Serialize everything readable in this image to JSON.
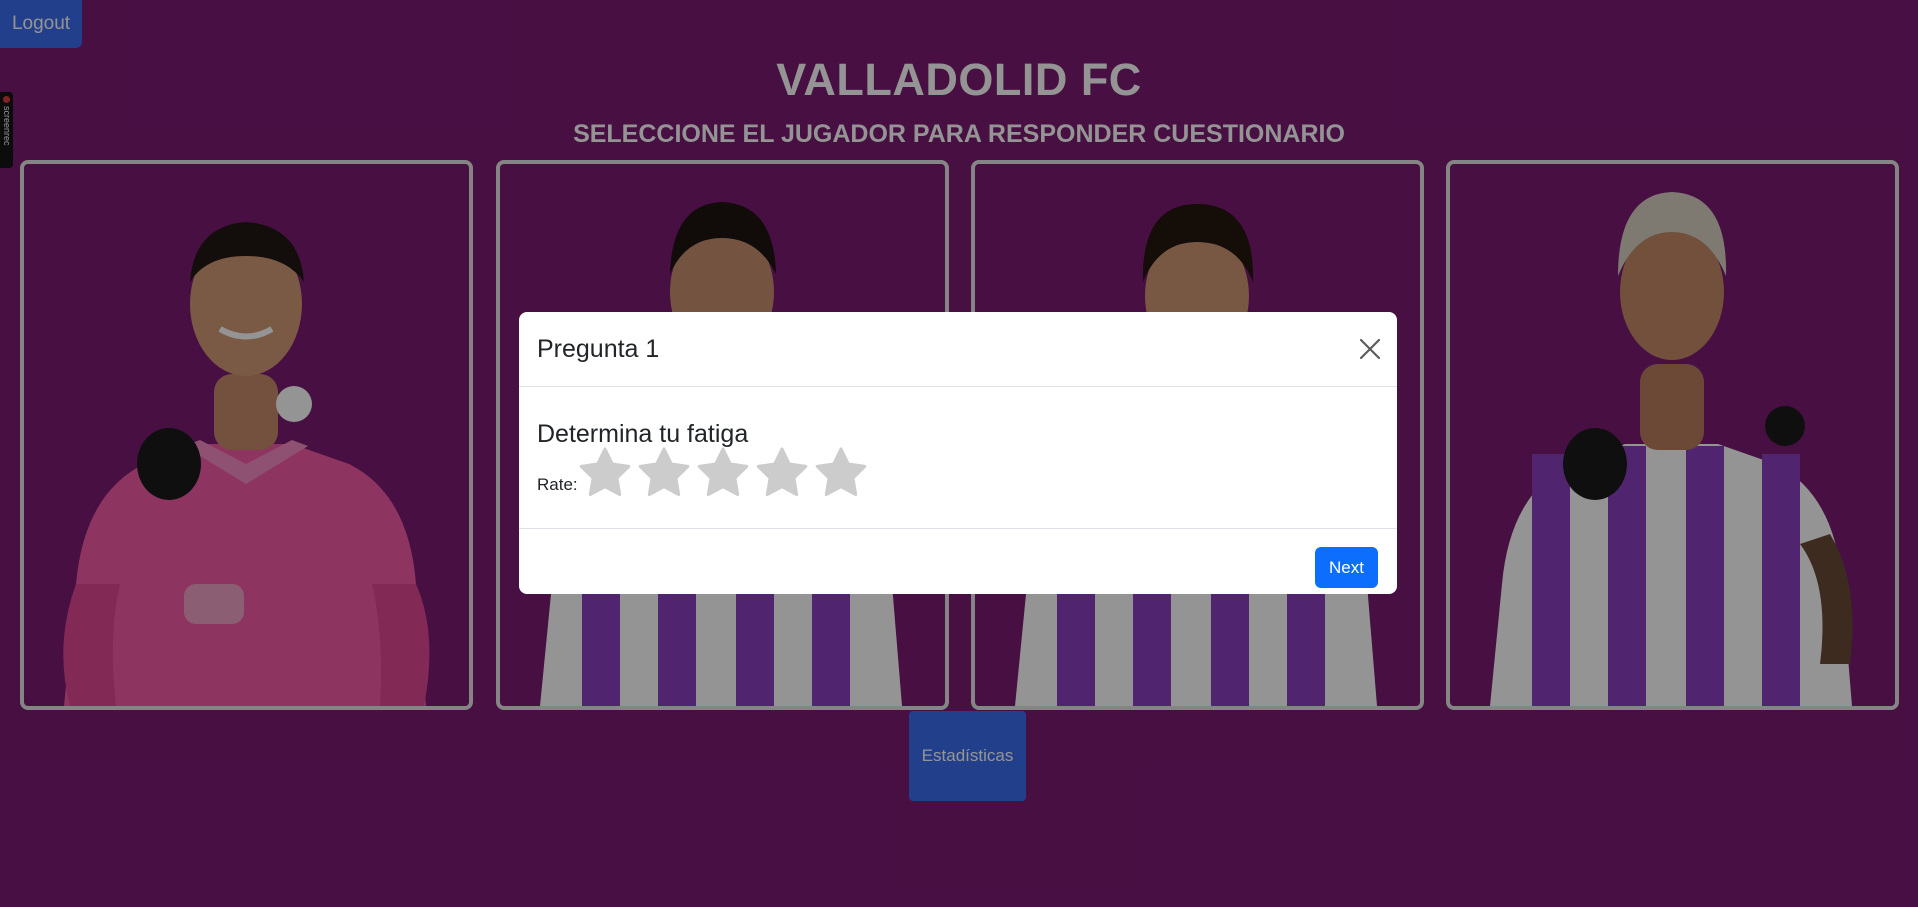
{
  "header": {
    "logout_label": "Logout",
    "title": "VALLADOLID FC",
    "subtitle": "SELECCIONE EL JUGADOR PARA RESPONDER CUESTIONARIO"
  },
  "recorder_badge": {
    "label": "screenrec"
  },
  "players": [
    {
      "kit": "pink goalkeeper kit"
    },
    {
      "kit": "purple and white striped kit"
    },
    {
      "kit": "purple and white striped kit"
    },
    {
      "kit": "purple and white striped kit"
    }
  ],
  "footer": {
    "stats_label": "Estadísticas"
  },
  "modal": {
    "title": "Pregunta 1",
    "question": "Determina tu fatiga",
    "rate_label": "Rate:",
    "rating": {
      "value": 0,
      "max": 5
    },
    "next_label": "Next",
    "close_icon": "close-icon",
    "star_icon": "star-icon"
  },
  "colors": {
    "background": "#7a1a73",
    "primary_button": "#3b6df0",
    "modal_next_button": "#0d6efd",
    "card_border": "#e6e6e6",
    "star_empty": "#cccccc",
    "backdrop": "rgba(0,0,0,0.42)"
  }
}
